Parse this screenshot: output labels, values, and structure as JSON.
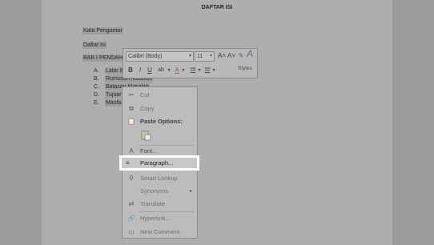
{
  "document": {
    "title": "DAFTAR ISI",
    "lines": [
      "Kata Pengantar",
      "Daftar Isi",
      "BAB I PENDAHUL"
    ],
    "list": [
      {
        "num": "A.",
        "text": "Latar B"
      },
      {
        "num": "B.",
        "text": "Rumusan Masalah"
      },
      {
        "num": "C.",
        "text": "Batasan Masalah"
      },
      {
        "num": "D.",
        "text": "Tujuan"
      },
      {
        "num": "E.",
        "text": "Manfaat"
      }
    ]
  },
  "mini_toolbar": {
    "font_name": "Calibri (Body)",
    "font_size": "11",
    "grow_font": "A˄",
    "shrink_font": "A˅",
    "bold": "B",
    "italic": "I",
    "underline": "U",
    "highlight": "ab",
    "font_color": "A",
    "styles_label": "Styles"
  },
  "context_menu": {
    "cut": "Cut",
    "copy": "Copy",
    "paste_options": "Paste Options:",
    "font": "Font...",
    "paragraph": "Paragraph...",
    "smart_lookup": "Smart Lookup",
    "synonyms": "Synonyms",
    "translate": "Translate",
    "hyperlink": "Hyperlink...",
    "new_comment": "New Comment"
  },
  "colors": {
    "overlay": "#9a9a9a",
    "highlight_border": "#ffffff"
  }
}
